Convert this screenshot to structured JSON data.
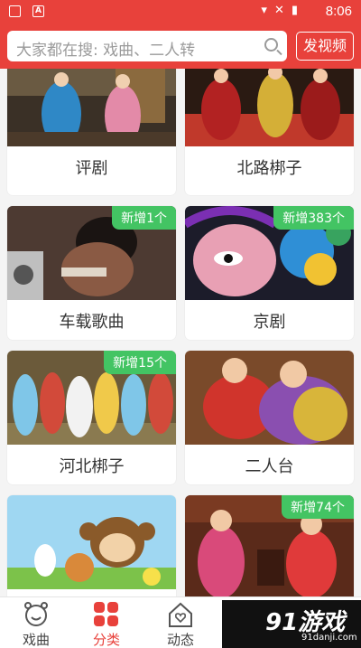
{
  "statusbar": {
    "time": "8:06"
  },
  "search": {
    "placeholder": "大家都在搜: 戏曲、二人转",
    "post_label": "发视频"
  },
  "cards": [
    {
      "name": "评剧",
      "badge": ""
    },
    {
      "name": "北路梆子",
      "badge": ""
    },
    {
      "name": "车载歌曲",
      "badge": "新增1个"
    },
    {
      "name": "京剧",
      "badge": "新增383个"
    },
    {
      "name": "河北梆子",
      "badge": "新增15个"
    },
    {
      "name": "二人台",
      "badge": ""
    },
    {
      "name": "",
      "badge": ""
    },
    {
      "name": "",
      "badge": "新增74个"
    }
  ],
  "tabs": [
    {
      "label": "戏曲",
      "icon": "smiley-clock-icon"
    },
    {
      "label": "分类",
      "icon": "category-icon"
    },
    {
      "label": "动态",
      "icon": "house-heart-icon"
    }
  ],
  "watermark": {
    "brand": "91游戏",
    "site": "91danji.com"
  },
  "colors": {
    "primary": "#e8413b",
    "badge": "#43c463"
  }
}
